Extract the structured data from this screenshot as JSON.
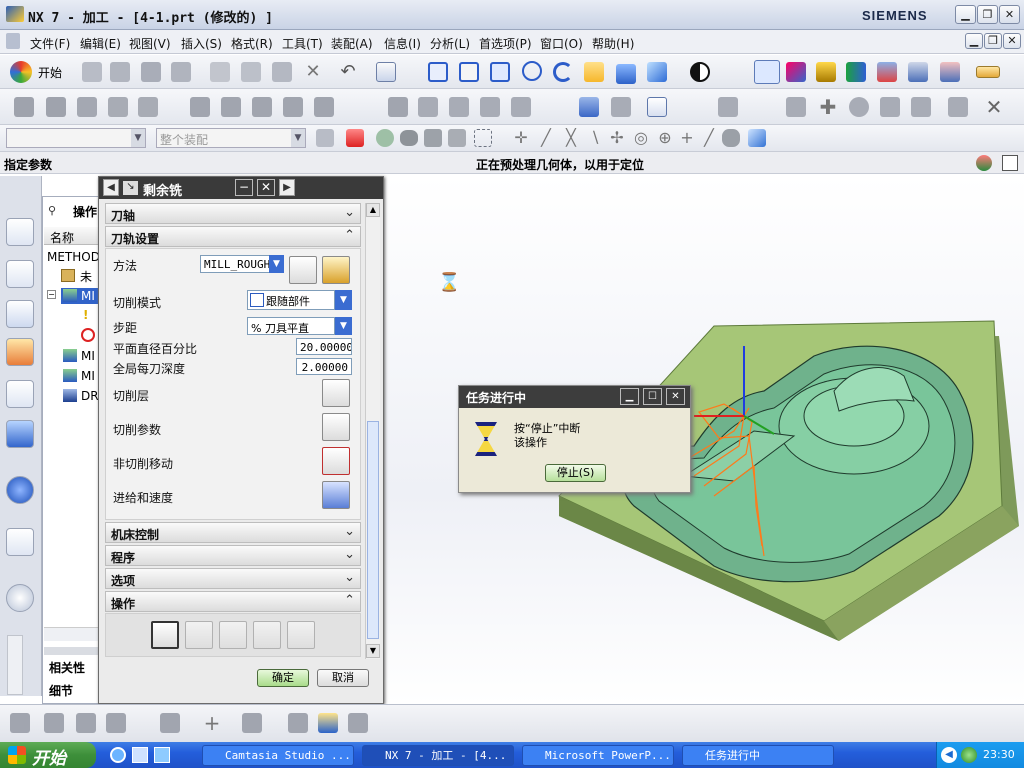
{
  "window": {
    "title": "NX 7 - 加工 - [4-1.prt  (修改的) ]",
    "brand": "SIEMENS"
  },
  "menu": [
    "文件(F)",
    "编辑(E)",
    "视图(V)",
    "插入(S)",
    "格式(R)",
    "工具(T)",
    "装配(A)",
    "信息(I)",
    "分析(L)",
    "首选项(P)",
    "窗口(O)",
    "帮助(H)"
  ],
  "toolbar": {
    "start_label": "开始",
    "filter_placeholder": "整个装配"
  },
  "status": {
    "left": "指定参数",
    "center": "正在预处理几何体，以用于定位"
  },
  "navigator": {
    "header": "操作",
    "column": "名称",
    "root": "METHOD",
    "items": [
      "未用",
      "MI",
      "",
      "",
      "MI",
      "MI",
      "DR"
    ],
    "bottom": [
      "相关性",
      "细节"
    ]
  },
  "dialog": {
    "title": "剩余铣",
    "sections": {
      "tool_axis": "刀轴",
      "path_settings": "刀轨设置",
      "machine_control": "机床控制",
      "program": "程序",
      "options": "选项",
      "operation": "操作"
    },
    "fields": {
      "method_label": "方法",
      "method_value": "MILL_ROUGH",
      "cut_pattern_label": "切削模式",
      "cut_pattern_value": "跟随部件",
      "stepover_label": "步距",
      "stepover_value": "% 刀具平直",
      "flat_pct_label": "平面直径百分比",
      "flat_pct_value": "20.00000",
      "depth_label": "全局每刀深度",
      "depth_value": "2.00000",
      "cut_levels_label": "切削层",
      "cut_params_label": "切削参数",
      "non_cut_label": "非切削移动",
      "feeds_label": "进给和速度"
    },
    "ok": "确定",
    "cancel": "取消"
  },
  "task_dialog": {
    "title": "任务进行中",
    "message_line1": "按“停止”中断",
    "message_line2": "该操作",
    "stop": "停止(S)"
  },
  "taskbar": {
    "start": "开始",
    "items": [
      "Camtasia Studio ...",
      "NX 7 - 加工 - [4...",
      "Microsoft PowerP...",
      "任务进行中"
    ],
    "clock": "23:30"
  },
  "colors": {
    "part": "#7dbf98",
    "base": "#a7c77a",
    "toolpath": "#ff7a1a",
    "taskbar": "#245edb"
  }
}
